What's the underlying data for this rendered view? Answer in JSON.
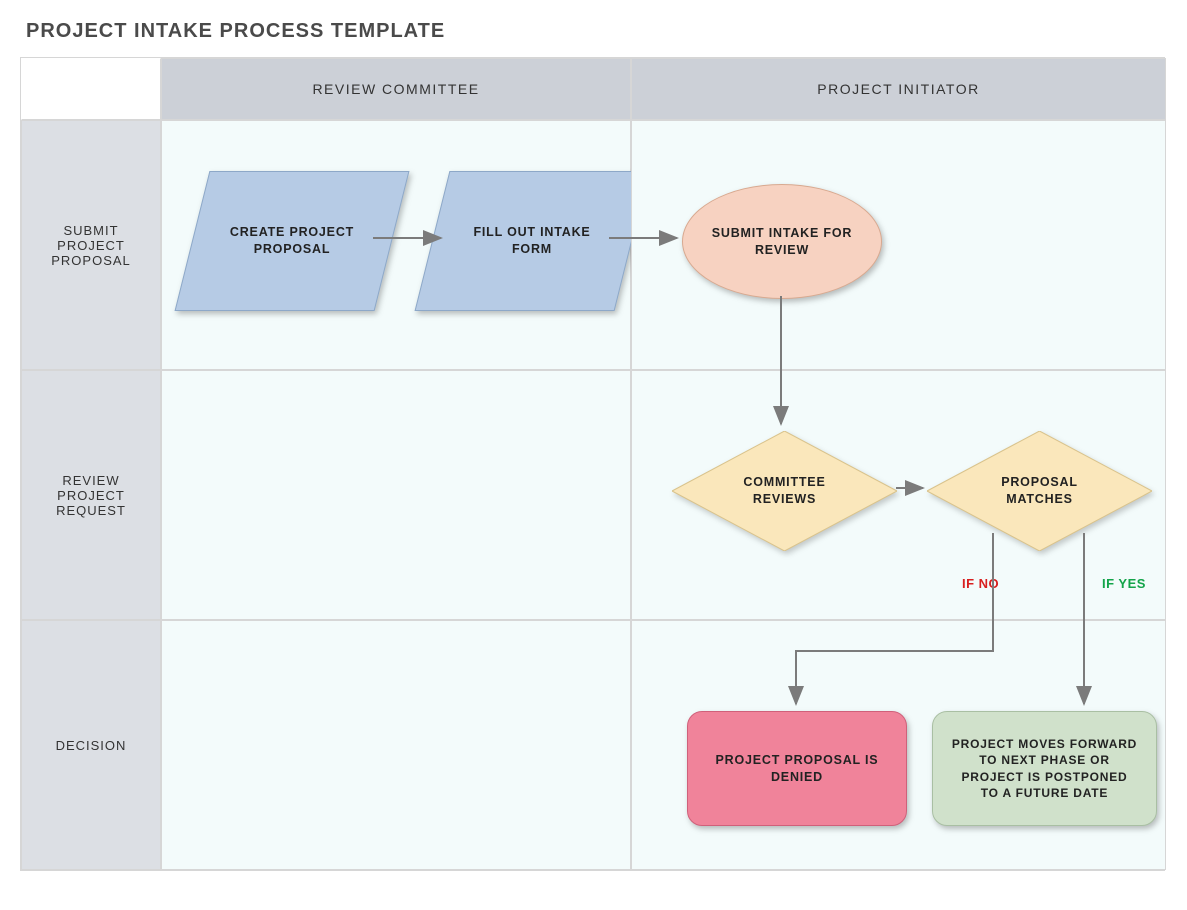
{
  "title": "PROJECT INTAKE PROCESS TEMPLATE",
  "columns": {
    "col1": "REVIEW COMMITTEE",
    "col2": "PROJECT INITIATOR"
  },
  "rows": {
    "row1": "SUBMIT PROJECT PROPOSAL",
    "row2": "REVIEW PROJECT REQUEST",
    "row3": "DECISION"
  },
  "nodes": {
    "create_proposal": "CREATE PROJECT PROPOSAL",
    "fill_intake": "FILL OUT INTAKE FORM",
    "submit_review": "SUBMIT INTAKE FOR REVIEW",
    "committee_reviews": "COMMITTEE REVIEWS",
    "proposal_matches": "PROPOSAL MATCHES",
    "denied": "PROJECT PROPOSAL IS DENIED",
    "forward": "PROJECT MOVES FORWARD TO NEXT PHASE OR PROJECT IS POSTPONED TO A FUTURE DATE"
  },
  "labels": {
    "if_no": "IF NO",
    "if_yes": "IF YES"
  },
  "colors": {
    "parallelogram": "#b6cbe5",
    "ellipse": "#f7d2c1",
    "diamond": "#fae7bb",
    "denied": "#f0839a",
    "forward": "#d0e1cb",
    "arrow": "#7b7b7b"
  }
}
